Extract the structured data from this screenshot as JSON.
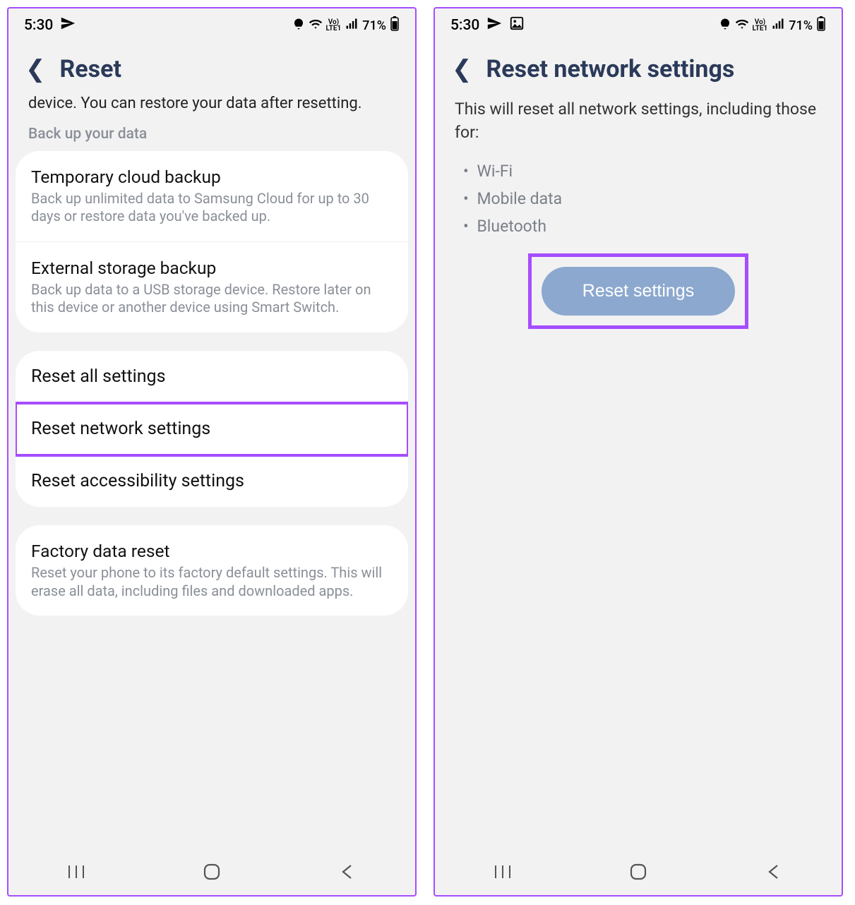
{
  "status": {
    "time": "5:30",
    "battery_pct": "71%"
  },
  "left": {
    "title": "Reset",
    "intro": "device. You can restore your data after resetting.",
    "section_label": "Back up your data",
    "backup": [
      {
        "title": "Temporary cloud backup",
        "sub": "Back up unlimited data to Samsung Cloud for up to 30 days or restore data you've backed up."
      },
      {
        "title": "External storage backup",
        "sub": "Back up data to a USB storage device. Restore later on this device or another device using Smart Switch."
      }
    ],
    "resets": [
      {
        "title": "Reset all settings"
      },
      {
        "title": "Reset network settings"
      },
      {
        "title": "Reset accessibility settings"
      }
    ],
    "factory": {
      "title": "Factory data reset",
      "sub": "Reset your phone to its factory default settings. This will erase all data, including files and downloaded apps."
    }
  },
  "right": {
    "title": "Reset network settings",
    "desc": "This will reset all network settings, including those for:",
    "bullets": [
      "Wi-Fi",
      "Mobile data",
      "Bluetooth"
    ],
    "button": "Reset settings"
  }
}
